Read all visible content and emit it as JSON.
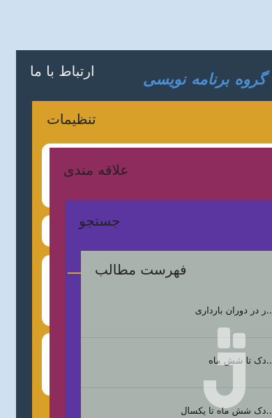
{
  "menu": {
    "contact": {
      "label": "ارتباط با ما"
    },
    "brand": {
      "logo_text": "گروه برنامه نویسی"
    },
    "settings": {
      "label": "تنظیمات"
    },
    "interests": {
      "label": "علاقه مندی"
    },
    "search": {
      "label": "جستجو"
    },
    "contents": {
      "label": "فهرست مطالب",
      "items": [
        {
          "label": "...ر در دوران بارداری"
        },
        {
          "label": "...دک تا شش ماه"
        },
        {
          "label": "...دک شش ماه تا یکسال"
        }
      ]
    }
  },
  "colors": {
    "background": "#cfe0f1",
    "contact_panel": "#2b3e50",
    "settings_panel": "#d9a029",
    "interests_panel": "#8e2c5e",
    "search_panel": "#5b35a0",
    "contents_panel": "#a9b2ad",
    "brand_logo": "#4a8fd4"
  },
  "watermark": {
    "icon": "app-store-logo-icon"
  }
}
